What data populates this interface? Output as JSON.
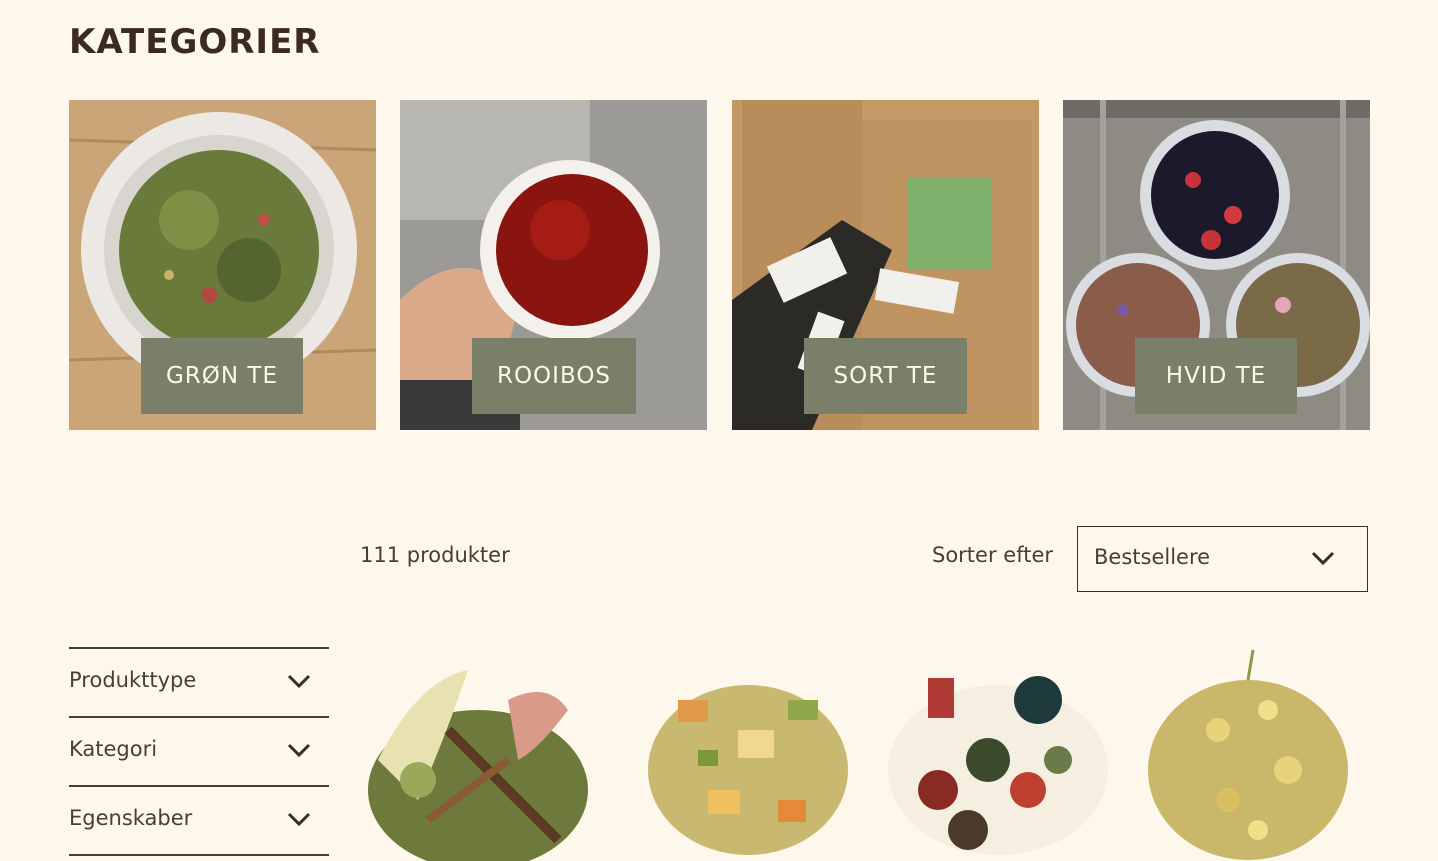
{
  "section_title": "KATEGORIER",
  "categories": [
    {
      "label": "GRØN TE"
    },
    {
      "label": "ROOIBOS"
    },
    {
      "label": "SORT TE"
    },
    {
      "label": "HVID TE"
    }
  ],
  "toolbar": {
    "product_count": "111 produkter",
    "sort_label": "Sorter efter",
    "sort_value": "Bestsellere"
  },
  "filters": [
    {
      "label": "Produkttype"
    },
    {
      "label": "Kategori"
    },
    {
      "label": "Egenskaber"
    }
  ],
  "colors": {
    "background": "#fdf7ec",
    "button": "#7a7f69",
    "text": "#3b2a1f"
  },
  "icons": {
    "chevron": "chevron-down-icon"
  }
}
